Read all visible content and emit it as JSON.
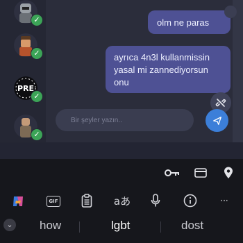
{
  "chat": {
    "messages": [
      {
        "text": "olm ne paras"
      },
      {
        "text": "ayrıca 4n3l kullanmissin\nyasal mi zannediyorsun\nonu"
      }
    ],
    "avatars": [
      {
        "icon": "robot-avatar-icon",
        "checked": true
      },
      {
        "icon": "character-avatar-icon",
        "checked": true
      },
      {
        "label": "PRE",
        "checked": true
      },
      {
        "icon": "character-avatar-icon",
        "checked": true
      }
    ],
    "input": {
      "placeholder": "Bir şeyler yazın..",
      "value": ""
    }
  },
  "keyboard": {
    "suggestions": [
      "how",
      "lgbt",
      "dost"
    ],
    "toolbar": {
      "gif_label": "GIF",
      "translate_glyph": "aあ",
      "more_glyph": "···"
    },
    "top_actions": [
      "key-icon",
      "card-icon",
      "location-pin-icon"
    ]
  },
  "colors": {
    "accent": "#3c7fd9",
    "bubble": "#4e5194",
    "check": "#3ca457"
  }
}
